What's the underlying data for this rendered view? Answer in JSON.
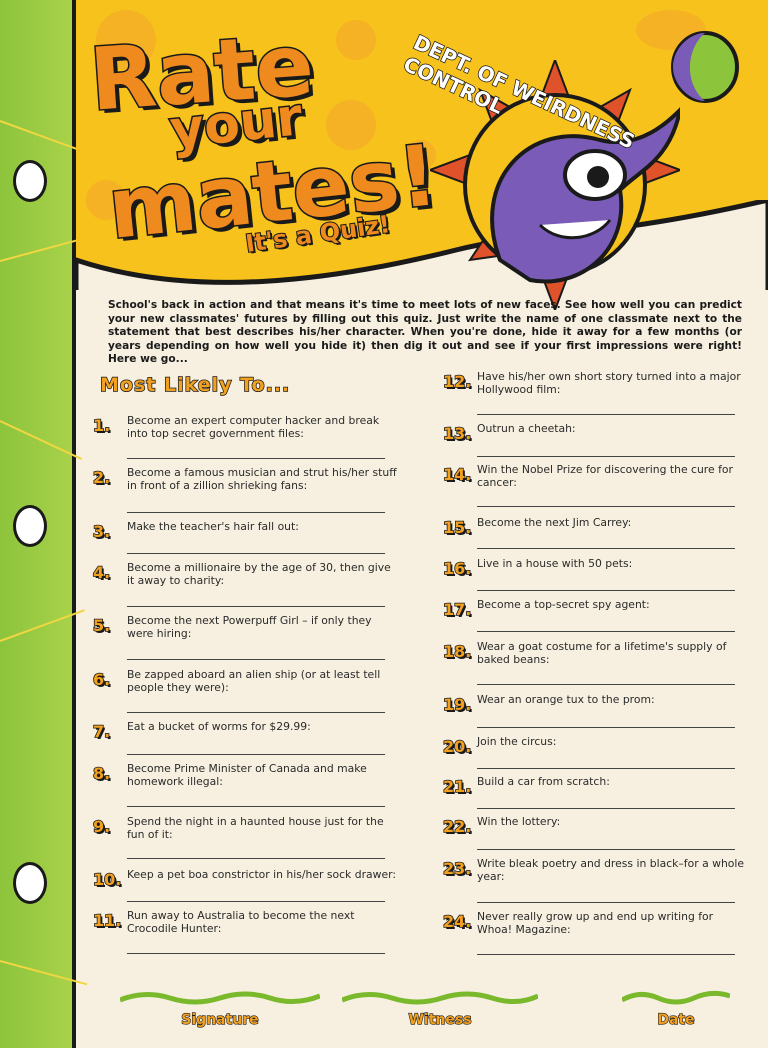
{
  "header": {
    "title_line1": "Rate",
    "title_line2": "your",
    "title_line3": "mates!",
    "subtitle": "It's a Quiz!",
    "badge_text": "DEPT. OF WEIRDNESS CONTROL"
  },
  "intro": "School's back in action and that means it's time to meet lots of new faces. See how well you can predict your new classmates' futures by filling out this quiz. Just write the name of one classmate next to the statement that best describes his/her character. When you're done, hide it away for a few months (or years depending on how well you hide it) then dig it out and see if your first impressions were right! Here we go...",
  "section_title": "Most Likely To...",
  "items": [
    {
      "num": "1.",
      "text": "Become an expert computer hacker and break into top secret government files:"
    },
    {
      "num": "2.",
      "text": "Become a famous musician and strut his/her stuff in front of a zillion shrieking fans:"
    },
    {
      "num": "3.",
      "text": "Make the teacher's hair fall out:"
    },
    {
      "num": "4.",
      "text": "Become a millionaire by the age of 30, then give it away to charity:"
    },
    {
      "num": "5.",
      "text": "Become the next Powerpuff Girl – if only they were hiring:"
    },
    {
      "num": "6.",
      "text": "Be zapped aboard an alien ship (or at least tell people they were):"
    },
    {
      "num": "7.",
      "text": "Eat a bucket of worms for $29.99:"
    },
    {
      "num": "8.",
      "text": "Become Prime Minister of Canada and make homework illegal:"
    },
    {
      "num": "9.",
      "text": "Spend the night in a haunted house just for the fun of it:"
    },
    {
      "num": "10.",
      "text": "Keep a pet boa constrictor in his/her sock drawer:"
    },
    {
      "num": "11.",
      "text": "Run away to Australia to become the next Crocodile Hunter:"
    },
    {
      "num": "12.",
      "text": "Have his/her own short story turned into a major Hollywood film:"
    },
    {
      "num": "13.",
      "text": "Outrun a cheetah:"
    },
    {
      "num": "14.",
      "text": "Win the Nobel Prize for discovering the cure for cancer:"
    },
    {
      "num": "15.",
      "text": "Become the next Jim Carrey:"
    },
    {
      "num": "16.",
      "text": "Live in a house with 50 pets:"
    },
    {
      "num": "17.",
      "text": "Become a top-secret spy agent:"
    },
    {
      "num": "18.",
      "text": "Wear a goat costume for a lifetime's supply of baked beans:"
    },
    {
      "num": "19.",
      "text": "Wear an orange tux to the prom:"
    },
    {
      "num": "20.",
      "text": "Join the circus:"
    },
    {
      "num": "21.",
      "text": "Build a car from scratch:"
    },
    {
      "num": "22.",
      "text": "Win the lottery:"
    },
    {
      "num": "23.",
      "text": "Write bleak poetry and dress in black–for a whole year:"
    },
    {
      "num": "24.",
      "text": "Never really grow up and end up writing for Whoa! Magazine:"
    }
  ],
  "footer": {
    "signature": "Signature",
    "witness": "Witness",
    "date": "Date"
  },
  "colors": {
    "orange": "#ee8a1e",
    "yellow": "#f7c21c",
    "green": "#8cc43c",
    "purple": "#7a5cb8"
  }
}
